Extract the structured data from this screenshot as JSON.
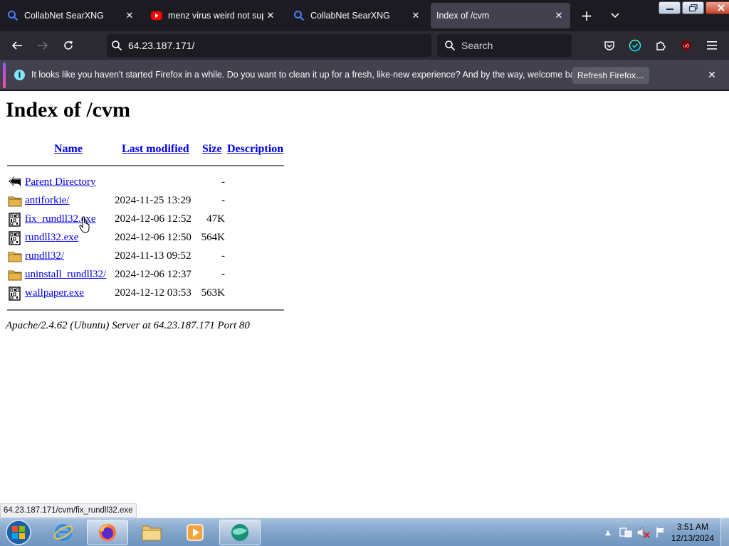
{
  "browser": {
    "tabs": [
      {
        "label": "CollabNet SearXNG",
        "icon": "search-icon"
      },
      {
        "label": "menz virus weird not supo",
        "icon": "youtube-icon"
      },
      {
        "label": "CollabNet SearXNG",
        "icon": "search-icon"
      },
      {
        "label": "Index of /cvm",
        "icon": "none",
        "active": true
      }
    ],
    "url": "64.23.187.171/",
    "search_placeholder": "Search",
    "notification": {
      "message": "It looks like you haven't started Firefox in a while. Do you want to clean it up for a fresh, like-new experience? And by the way, welcome back!",
      "button": "Refresh Firefox…"
    },
    "status_link": "64.23.187.171/cvm/fix_rundll32.exe"
  },
  "page": {
    "title": "Index of /cvm",
    "headers": {
      "name": "Name",
      "modified": "Last modified",
      "size": "Size",
      "description": "Description"
    },
    "rows": [
      {
        "icon": "back-icon",
        "name": "Parent Directory",
        "modified": "",
        "size": "-"
      },
      {
        "icon": "folder-icon",
        "name": "antiforkie/",
        "modified": "2024-11-25 13:29",
        "size": "-"
      },
      {
        "icon": "binary-file-icon",
        "name": "fix_rundll32.exe",
        "modified": "2024-12-06 12:52",
        "size": "47K"
      },
      {
        "icon": "binary-file-icon",
        "name": "rundll32.exe",
        "modified": "2024-12-06 12:50",
        "size": "564K"
      },
      {
        "icon": "folder-icon",
        "name": "rundll32/",
        "modified": "2024-11-13 09:52",
        "size": "-"
      },
      {
        "icon": "folder-icon",
        "name": "uninstall_rundll32/",
        "modified": "2024-12-06 12:37",
        "size": "-"
      },
      {
        "icon": "binary-file-icon",
        "name": "wallpaper.exe",
        "modified": "2024-12-12 03:53",
        "size": "563K"
      }
    ],
    "footer": "Apache/2.4.62 (Ubuntu) Server at 64.23.187.171 Port 80"
  },
  "taskbar": {
    "time": "3:51 AM",
    "date": "12/13/2024"
  },
  "colors": {
    "link": "#0000ee",
    "tab_bg": "#1c1b22",
    "nav_bg": "#2b2a33"
  }
}
